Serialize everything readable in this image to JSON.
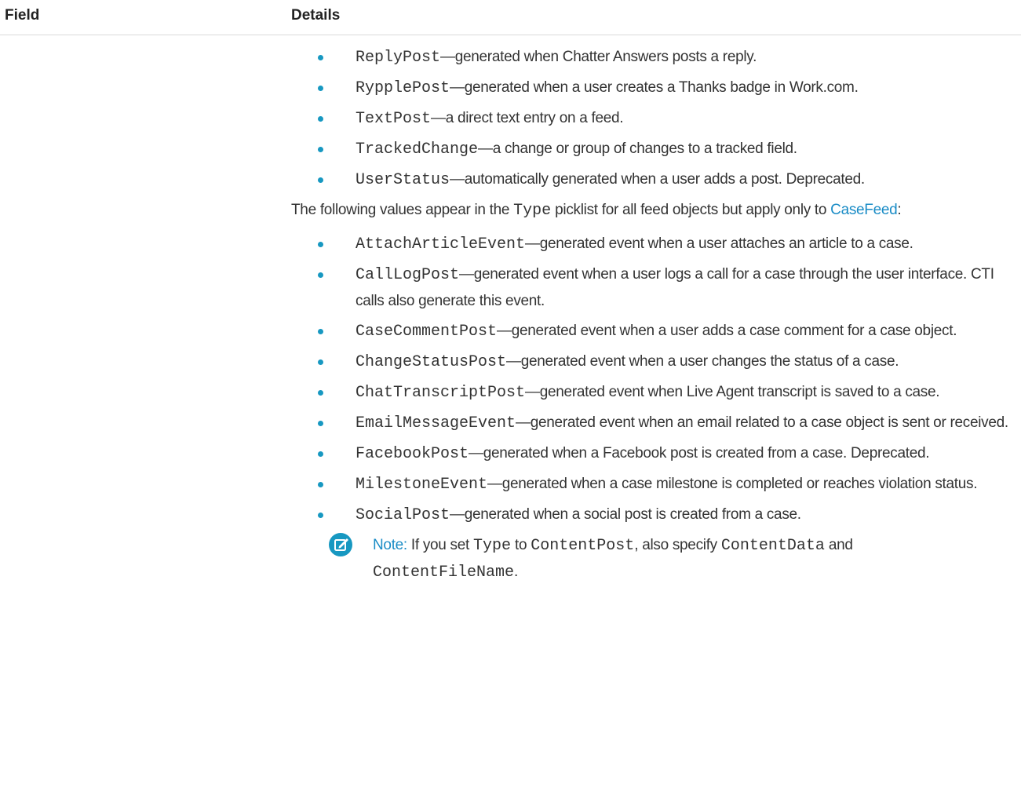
{
  "header": {
    "field_label": "Field",
    "details_label": "Details"
  },
  "bullets_top": [
    {
      "code": "ReplyPost",
      "desc": "—generated when Chatter Answers posts a reply."
    },
    {
      "code": "RypplePost",
      "desc": "—generated when a user creates a Thanks badge in Work.com."
    },
    {
      "code": "TextPost",
      "desc": "—a direct text entry on a feed."
    },
    {
      "code": "TrackedChange",
      "desc": "—a change or group of changes to a tracked field."
    },
    {
      "code": "UserStatus",
      "desc": "—automatically generated when a user adds a post. Deprecated."
    }
  ],
  "para": {
    "before": "The following values appear in the ",
    "code": "Type",
    "after": " picklist for all feed objects but apply only to ",
    "link": "CaseFeed",
    "end": ":"
  },
  "bullets_case": [
    {
      "code": "AttachArticleEvent",
      "desc": "—generated event when a user attaches an article to a case."
    },
    {
      "code": "CallLogPost",
      "desc": "—generated event when a user logs a call for a case through the user interface. CTI calls also generate this event."
    },
    {
      "code": "CaseCommentPost",
      "desc": "—generated event when a user adds a case comment for a case object."
    },
    {
      "code": "ChangeStatusPost",
      "desc": "—generated event when a user changes the status of a case."
    },
    {
      "code": "ChatTranscriptPost",
      "desc": "—generated event when Live Agent transcript is saved to a case."
    },
    {
      "code": "EmailMessageEvent",
      "desc": "—generated event when an email related to a case object is sent or received."
    },
    {
      "code": "FacebookPost",
      "desc": "—generated when a Facebook post is created from a case. Deprecated."
    },
    {
      "code": "MilestoneEvent",
      "desc": "—generated when a case milestone is completed or reaches violation status."
    },
    {
      "code": "SocialPost",
      "desc": "—generated when a social post is created from a case."
    }
  ],
  "note": {
    "icon": "edit-note-icon",
    "label": "Note:",
    "text1": " If you set ",
    "code1": "Type",
    "text2": " to ",
    "code2": "ContentPost",
    "text3": ", also specify ",
    "code3": "ContentData",
    "text4": " and ",
    "code4": "ContentFileName",
    "text5": "."
  },
  "colors": {
    "accent": "#1798c1",
    "link": "#1a8cc6",
    "text": "#333333"
  }
}
